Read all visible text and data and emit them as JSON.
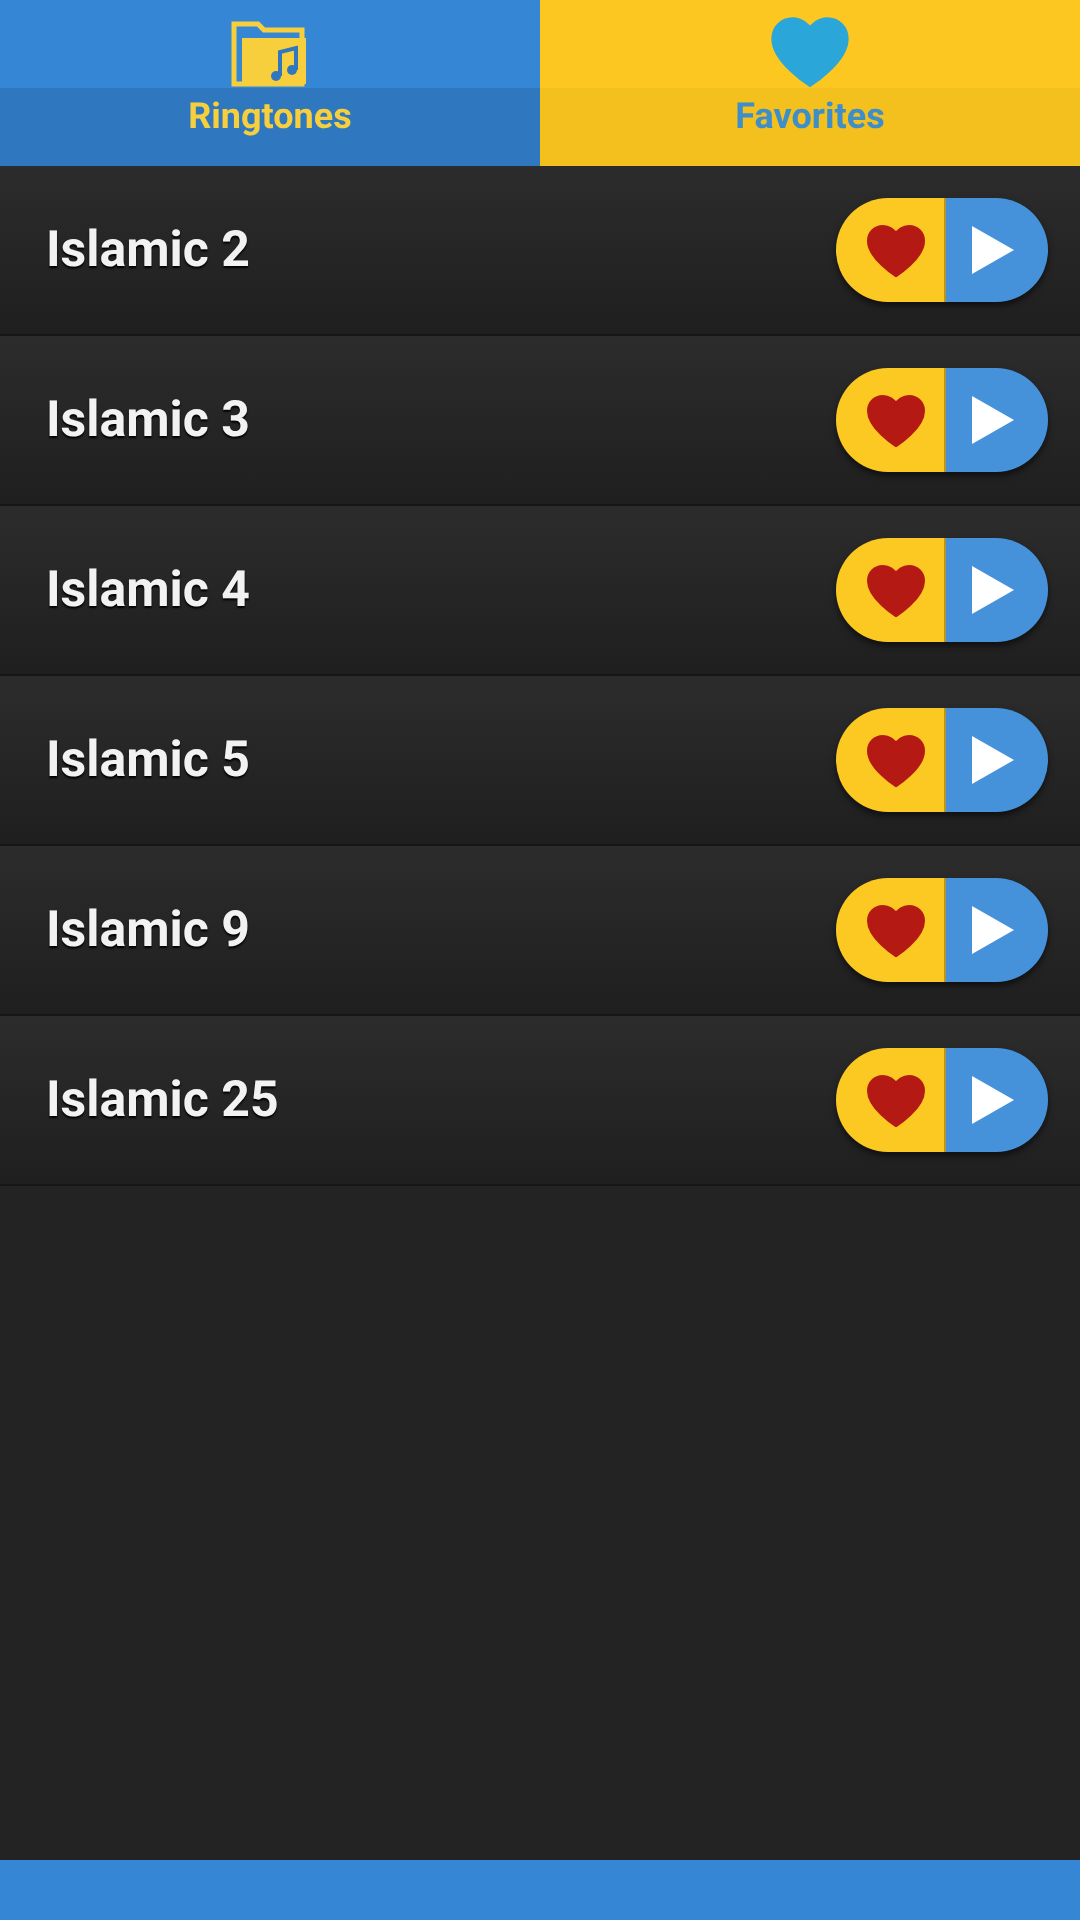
{
  "tabs": [
    {
      "label": "Ringtones",
      "kind": "folder",
      "selected": false
    },
    {
      "label": "Favorites",
      "kind": "heart",
      "selected": true
    }
  ],
  "ringtones": [
    {
      "name": "Islamic 2",
      "favorite": true
    },
    {
      "name": "Islamic 3",
      "favorite": true
    },
    {
      "name": "Islamic 4",
      "favorite": true
    },
    {
      "name": "Islamic 5",
      "favorite": true
    },
    {
      "name": "Islamic 9",
      "favorite": true
    },
    {
      "name": "Islamic 25",
      "favorite": true
    }
  ]
}
